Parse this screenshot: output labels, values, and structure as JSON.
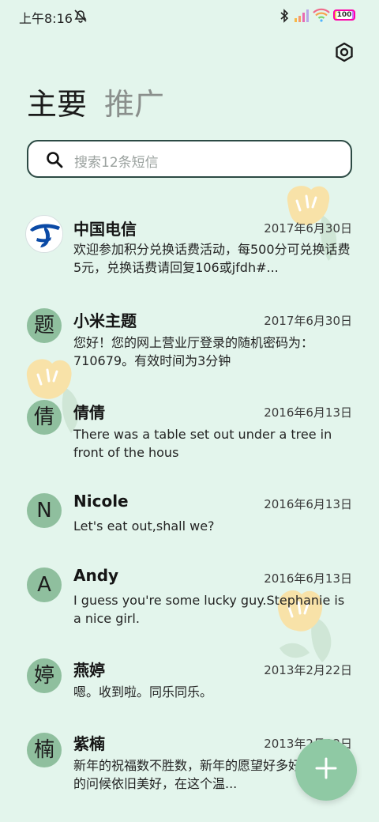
{
  "status_bar": {
    "time": "上午8:16",
    "battery": "100"
  },
  "tabs": {
    "main": "主要",
    "promo": "推广"
  },
  "search": {
    "placeholder": "搜索12条短信"
  },
  "conversations": [
    {
      "avatar": "",
      "name": "中国电信",
      "date": "2017年6月30日",
      "message": "欢迎参加积分兑换话费活动，每500分可兑换话费5元，兑换话费请回复106或jfdh#..."
    },
    {
      "avatar": "题",
      "name": "小米主题",
      "date": "2017年6月30日",
      "message": "您好！您的网上营业厅登录的随机密码为：710679。有效时间为3分钟"
    },
    {
      "avatar": "倩",
      "name": "倩倩",
      "date": "2016年6月13日",
      "message": "There was a table set out under a tree in front of the hous"
    },
    {
      "avatar": "N",
      "name": "Nicole",
      "date": "2016年6月13日",
      "message": "Let's eat out,shall we?"
    },
    {
      "avatar": "A",
      "name": "Andy",
      "date": "2016年6月13日",
      "message": "I guess you're some lucky guy.Stephanie is a nice girl."
    },
    {
      "avatar": "婷",
      "name": "燕婷",
      "date": "2013年2月22日",
      "message": "嗯。收到啦。同乐同乐。"
    },
    {
      "avatar": "楠",
      "name": "紫楠",
      "date": "2013年2月22日",
      "message": "新年的祝福数不胜数，新年的愿望好多好多，新年的问候依旧美好，在这个温..."
    }
  ],
  "colors": {
    "background": "#e3f5ec",
    "avatar": "#8fbf9e",
    "fab": "#8fc9a4",
    "accent": "#2c4a44"
  },
  "icons": [
    "mute-icon",
    "bluetooth-icon",
    "signal-icon",
    "wifi-icon",
    "battery-icon",
    "settings-icon",
    "search-icon",
    "plus-icon"
  ]
}
